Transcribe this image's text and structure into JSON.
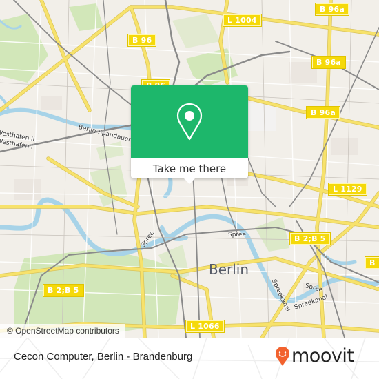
{
  "map": {
    "city_label": "Berlin",
    "road_labels": [
      {
        "id": "b96-nw",
        "text": "B 96"
      },
      {
        "id": "b96-popup",
        "text": "B 96"
      },
      {
        "id": "l1004",
        "text": "L 1004"
      },
      {
        "id": "b96a-1",
        "text": "B 96a"
      },
      {
        "id": "b96a-2",
        "text": "B 96a"
      },
      {
        "id": "b96a-3",
        "text": "B 96a"
      },
      {
        "id": "l1129",
        "text": "L 1129"
      },
      {
        "id": "b2b5-east",
        "text": "B 2;B 5"
      },
      {
        "id": "b2b5-west",
        "text": "B 2;B 5"
      },
      {
        "id": "b-edge",
        "text": "B"
      },
      {
        "id": "l1066",
        "text": "L 1066"
      }
    ],
    "water_labels": [
      {
        "id": "canal",
        "text": "Berlin-Spandauer Schifffahrtskanal"
      },
      {
        "id": "westhafen2",
        "text": "Westhafen II"
      },
      {
        "id": "westhafen1",
        "text": "Westhafen I"
      },
      {
        "id": "spree-1",
        "text": "Spree"
      },
      {
        "id": "spree-2",
        "text": "Spree"
      },
      {
        "id": "spree-3",
        "text": "Spree"
      },
      {
        "id": "spreekanal-1",
        "text": "Spreekanal"
      },
      {
        "id": "spreekanal-2",
        "text": "Spreekanal"
      }
    ],
    "attribution": "© OpenStreetMap contributors"
  },
  "popup": {
    "icon": "map-pin-icon",
    "button_label": "Take me there",
    "accent_color": "#1db76b"
  },
  "footer": {
    "place_title": "Cecon Computer, Berlin - Brandenburg",
    "brand_name": "moovit",
    "brand_icon": "moovit-pin-logo-icon",
    "brand_color": "#f2622e"
  }
}
